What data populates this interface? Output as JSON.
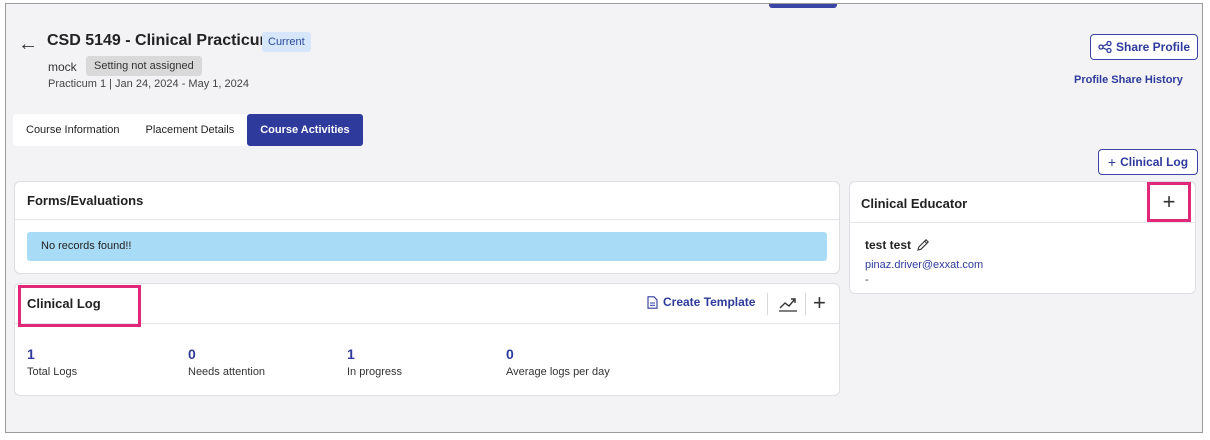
{
  "header": {
    "back": "←",
    "title": "CSD 5149 - Clinical Practicum",
    "status_badge": "Current",
    "site": "mock",
    "setting_badge": "Setting not assigned",
    "practicum_info": "Practicum 1  |  Jan 24, 2024 - May 1, 2024",
    "share_profile_label": "Share Profile",
    "share_history_label": "Profile Share History"
  },
  "tabs": [
    {
      "label": "Course Information",
      "active": false
    },
    {
      "label": "Placement Details",
      "active": false
    },
    {
      "label": "Course Activities",
      "active": true
    }
  ],
  "actions": {
    "clinical_log_button": "Clinical Log",
    "plus": "+"
  },
  "forms": {
    "title": "Forms/Evaluations",
    "empty_message": "No records found!!"
  },
  "clinical_log": {
    "title": "Clinical Log",
    "create_template_label": "Create Template",
    "stats": [
      {
        "value": "1",
        "label": "Total Logs"
      },
      {
        "value": "0",
        "label": "Needs attention"
      },
      {
        "value": "1",
        "label": "In progress"
      },
      {
        "value": "0",
        "label": "Average logs per day"
      }
    ]
  },
  "educator": {
    "title": "Clinical Educator",
    "name": "test test",
    "email": "pinaz.driver@exxat.com",
    "extra": "-"
  },
  "colors": {
    "primary": "#2e3a9c",
    "highlight": "#e0287a",
    "info_banner": "#a8dcf6"
  },
  "icons": [
    "back-arrow-icon",
    "share-icon",
    "plus-icon",
    "document-icon",
    "chart-icon",
    "pencil-icon"
  ]
}
